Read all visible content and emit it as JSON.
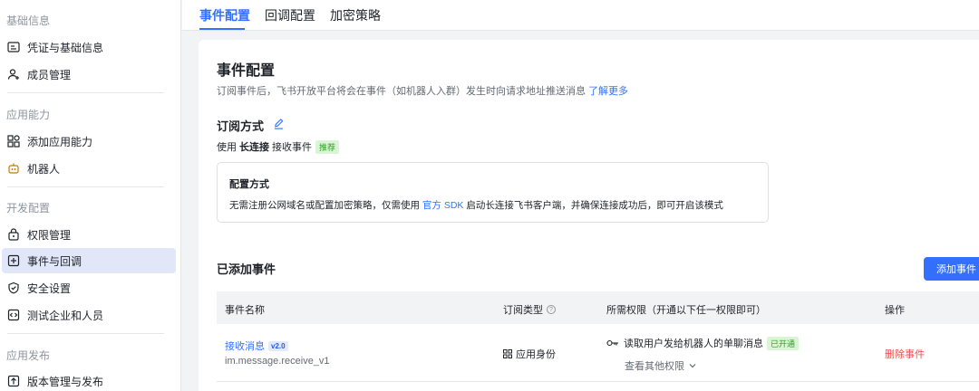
{
  "sidebar": {
    "groups": [
      {
        "title": "基础信息",
        "items": [
          {
            "label": "凭证与基础信息",
            "icon": "id-card-icon"
          },
          {
            "label": "成员管理",
            "icon": "user-add-icon"
          }
        ]
      },
      {
        "title": "应用能力",
        "items": [
          {
            "label": "添加应用能力",
            "icon": "apps-add-icon"
          },
          {
            "label": "机器人",
            "icon": "robot-icon"
          }
        ]
      },
      {
        "title": "开发配置",
        "items": [
          {
            "label": "权限管理",
            "icon": "lock-icon"
          },
          {
            "label": "事件与回调",
            "icon": "event-icon",
            "active": true
          },
          {
            "label": "安全设置",
            "icon": "shield-icon"
          },
          {
            "label": "测试企业和人员",
            "icon": "test-icon"
          }
        ]
      },
      {
        "title": "应用发布",
        "items": [
          {
            "label": "版本管理与发布",
            "icon": "upload-icon"
          }
        ]
      }
    ]
  },
  "tabs": [
    {
      "label": "事件配置",
      "active": true
    },
    {
      "label": "回调配置"
    },
    {
      "label": "加密策略"
    }
  ],
  "main": {
    "title": "事件配置",
    "description": "订阅事件后，飞书开放平台将会在事件（如机器人入群）发生时向请求地址推送消息",
    "learn_more": "了解更多",
    "subscribe_title": "订阅方式",
    "sub_prefix": "使用",
    "sub_mode": "长连接",
    "sub_suffix": "接收事件",
    "recommend_tag": "推荐",
    "config_box": {
      "title": "配置方式",
      "text_before": "无需注册公网域名或配置加密策略，仅需使用",
      "sdk_link": "官方 SDK",
      "text_after": "启动长连接飞书客户端，并确保连接成功后，即可开启该模式"
    },
    "added_title": "已添加事件",
    "add_button": "添加事件",
    "table": {
      "headers": [
        "事件名称",
        "订阅类型",
        "所需权限（开通以下任一权限即可）",
        "操作"
      ],
      "rows": [
        {
          "name": "接收消息",
          "version": "v2.0",
          "code": "im.message.receive_v1",
          "sub_type": "应用身份",
          "permission": "读取用户发给机器人的单聊消息",
          "permission_tag": "已开通",
          "more_permissions": "查看其他权限",
          "action": "删除事件"
        }
      ]
    }
  },
  "colors": {
    "accent": "#3370ff",
    "danger": "#f54a45",
    "success": "#2ea121"
  }
}
